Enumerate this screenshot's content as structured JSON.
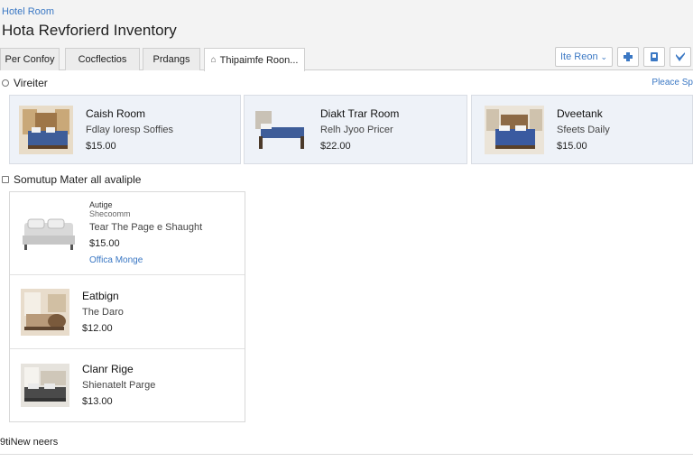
{
  "header": {
    "breadcrumb": "Hotel Room",
    "title": "Hota Revforierd Inventory"
  },
  "tabs": [
    {
      "label": "Per Confoy",
      "active": false
    },
    {
      "label": "Cocflectios",
      "active": false
    },
    {
      "label": "Prdangs",
      "active": false
    },
    {
      "label": "Thipaimfe Roon...",
      "active": true
    }
  ],
  "toolbar": {
    "select_label": "Ite Reon",
    "icons": [
      "plug-icon",
      "bookmark-icon",
      "twitter-icon"
    ]
  },
  "featured": {
    "label": "Vireiter",
    "right_link": "Pleace Sp",
    "rooms": [
      {
        "name": "Caish Room",
        "sub": "Fdlay Ioresp Soffies",
        "price": "$15.00"
      },
      {
        "name": "Diakt Trar Room",
        "sub": "Relh Jyoo Pricer",
        "price": "$22.00"
      },
      {
        "name": "Dveetank",
        "sub": "Sfeets Daily",
        "price": "$15.00"
      }
    ]
  },
  "available": {
    "label": "Somutup Mater all avaliple",
    "rooms": [
      {
        "tag": "Autige",
        "tag2": "Shecoomm",
        "name": "Tear The Page e Shaught",
        "price": "$15.00",
        "link": "Offica Monge"
      },
      {
        "name": "Eatbign",
        "sub": "The Daro",
        "price": "$12.00"
      },
      {
        "name": "Clanr Rige",
        "sub": "Shienatelt Parge",
        "price": "$13.00"
      }
    ]
  },
  "footer": {
    "label": "9tiNew neers"
  },
  "colors": {
    "accent": "#3b78c4",
    "card_bg": "#eef2f8",
    "bed_blue": "#3e5d99"
  }
}
